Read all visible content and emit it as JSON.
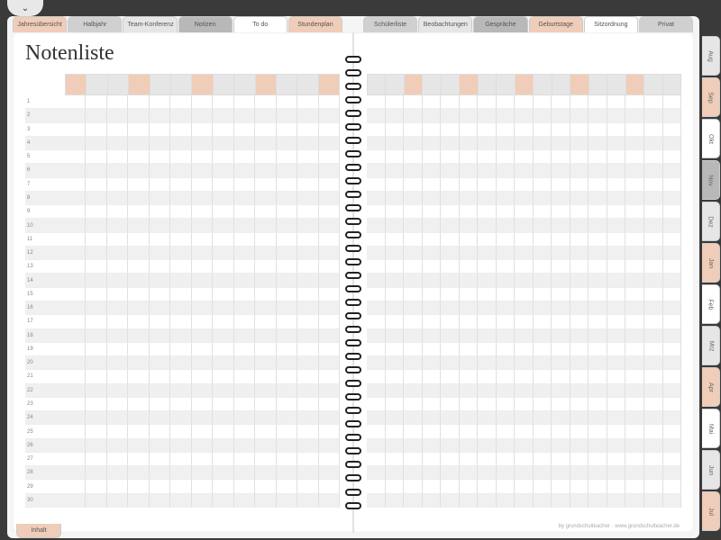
{
  "pull_tab_glyph": "⌄",
  "page_title": "Notenliste",
  "top_tabs": [
    {
      "label": "Jahresübersicht",
      "color": "c-peach"
    },
    {
      "label": "Halbjahr",
      "color": "c-grey"
    },
    {
      "label": "Team-Konferenz",
      "color": "c-lgrey"
    },
    {
      "label": "Notizen",
      "color": "c-dgrey"
    },
    {
      "label": "To do",
      "color": "c-white"
    },
    {
      "label": "Stundenplan",
      "color": "c-peach"
    }
  ],
  "top_tabs_right": [
    {
      "label": "Schülerliste",
      "color": "c-grey"
    },
    {
      "label": "Beobachtungen",
      "color": "c-lgrey"
    },
    {
      "label": "Gespräche",
      "color": "c-dgrey"
    },
    {
      "label": "Geburtstage",
      "color": "c-peach"
    },
    {
      "label": "Sitzordnung",
      "color": "c-white"
    },
    {
      "label": "Privat",
      "color": "c-grey"
    }
  ],
  "month_tabs": [
    {
      "label": "Aug",
      "color": "c-lgrey"
    },
    {
      "label": "Sep",
      "color": "c-peach"
    },
    {
      "label": "Okt",
      "color": "c-white"
    },
    {
      "label": "Nov",
      "color": "c-dgrey"
    },
    {
      "label": "Dez",
      "color": "c-lgrey"
    },
    {
      "label": "Jan",
      "color": "c-peach"
    },
    {
      "label": "Feb",
      "color": "c-white"
    },
    {
      "label": "Mrz",
      "color": "c-lgrey"
    },
    {
      "label": "Apr",
      "color": "c-peach"
    },
    {
      "label": "Mai",
      "color": "c-white"
    },
    {
      "label": "Jun",
      "color": "c-lgrey"
    },
    {
      "label": "Jul",
      "color": "c-peach"
    }
  ],
  "header_colors_left": [
    "c-peach",
    "c-lgrey",
    "c-lgrey",
    "c-peach",
    "c-lgrey",
    "c-lgrey",
    "c-peach",
    "c-lgrey",
    "c-lgrey",
    "c-peach",
    "c-lgrey",
    "c-lgrey",
    "c-peach"
  ],
  "header_colors_right": [
    "c-lgrey",
    "c-lgrey",
    "c-peach",
    "c-lgrey",
    "c-lgrey",
    "c-peach",
    "c-lgrey",
    "c-lgrey",
    "c-peach",
    "c-lgrey",
    "c-lgrey",
    "c-peach",
    "c-lgrey",
    "c-lgrey",
    "c-peach",
    "c-lgrey",
    "c-lgrey"
  ],
  "rows": [
    "1",
    "2",
    "3",
    "4",
    "5",
    "6",
    "7",
    "8",
    "9",
    "10",
    "11",
    "12",
    "13",
    "14",
    "15",
    "16",
    "17",
    "18",
    "19",
    "20",
    "21",
    "22",
    "23",
    "24",
    "25",
    "26",
    "27",
    "28",
    "29",
    "30"
  ],
  "inhalt_label": "Inhalt",
  "footer_credit": "by grundschulteacher · www.grundschulteacher.de"
}
